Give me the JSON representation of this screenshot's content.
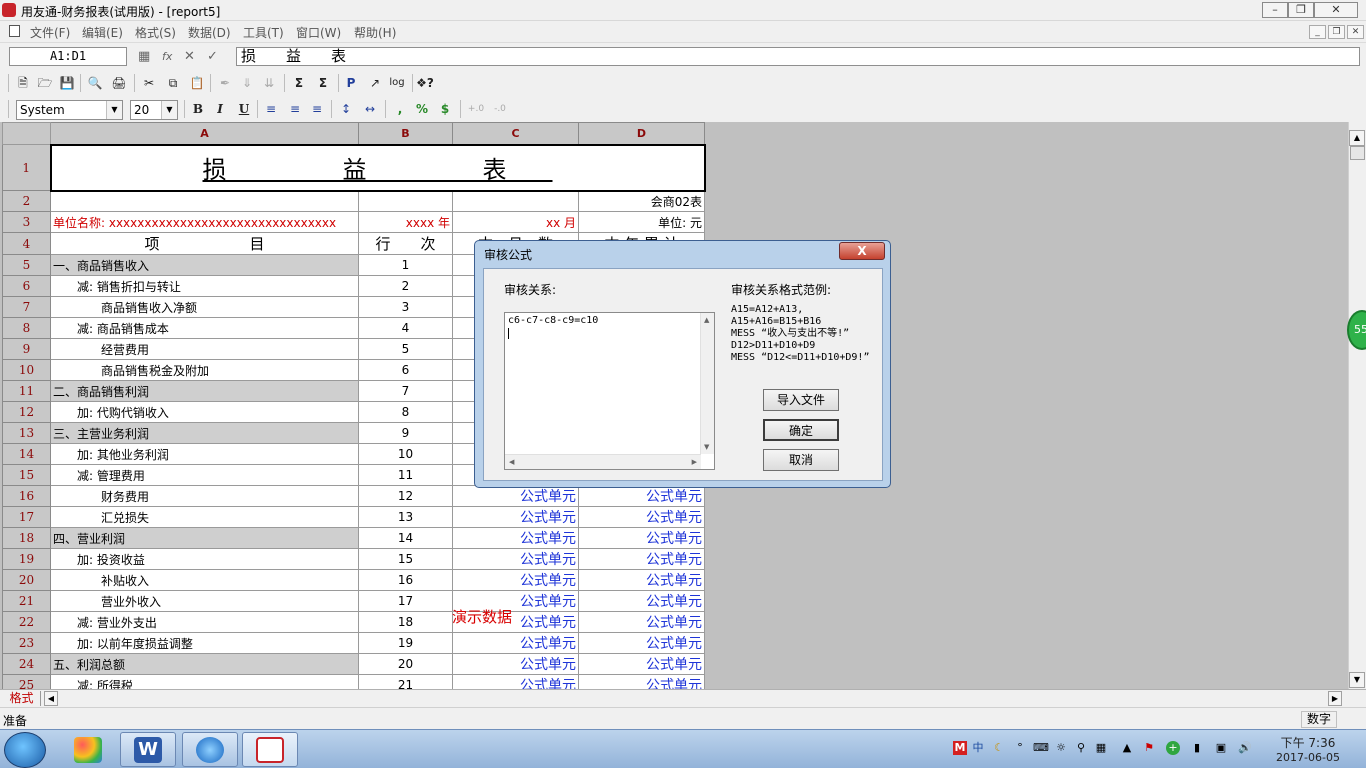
{
  "window": {
    "title": "用友通-财务报表(试用版) - [report5]",
    "controls": [
      "minimize",
      "restore",
      "close"
    ]
  },
  "menu": [
    "文件(F)",
    "编辑(E)",
    "格式(S)",
    "数据(D)",
    "工具(T)",
    "窗口(W)",
    "帮助(H)"
  ],
  "formula_bar": {
    "cell_ref": "A1:D1",
    "fx_label": "fx",
    "content": "损　　益　　表"
  },
  "format_bar": {
    "font": "System",
    "size": "20",
    "bold": "B",
    "italic": "I",
    "underline": "U",
    "comma": ",",
    "percent": "%",
    "currency": "$",
    "dec_add": "+.0",
    "dec_remove": "-.0"
  },
  "sheet": {
    "columns": [
      "A",
      "B",
      "C",
      "D"
    ],
    "title": "损　益　表",
    "row2_d": "会商02表",
    "row3": {
      "a": "单位名称: xxxxxxxxxxxxxxxxxxxxxxxxxxxxxxxx",
      "b": "xxxx 年",
      "c": "xx 月",
      "d": "单位: 元"
    },
    "row4": {
      "a": "项　　　　　　目",
      "b": "行　　次",
      "c": "本　月　数",
      "d": "本 年 累 计"
    },
    "rows": [
      {
        "n": "5",
        "item": "一、商品销售收入",
        "line": "1",
        "gray": true,
        "c": "",
        "d": ""
      },
      {
        "n": "6",
        "item": "　　减: 销售折扣与转让",
        "line": "2",
        "gray": false,
        "c": "",
        "d": ""
      },
      {
        "n": "7",
        "item": "　　　　商品销售收入净额",
        "line": "3",
        "gray": false,
        "c": "",
        "d": ""
      },
      {
        "n": "8",
        "item": "　　减: 商品销售成本",
        "line": "4",
        "gray": false,
        "c": "",
        "d": ""
      },
      {
        "n": "9",
        "item": "　　　　经营费用",
        "line": "5",
        "gray": false,
        "c": "",
        "d": ""
      },
      {
        "n": "10",
        "item": "　　　　商品销售税金及附加",
        "line": "6",
        "gray": false,
        "c": "",
        "d": ""
      },
      {
        "n": "11",
        "item": "二、商品销售利润",
        "line": "7",
        "gray": true,
        "c": "",
        "d": ""
      },
      {
        "n": "12",
        "item": "　　加: 代购代销收入",
        "line": "8",
        "gray": false,
        "c": "",
        "d": ""
      },
      {
        "n": "13",
        "item": "三、主营业务利润",
        "line": "9",
        "gray": true,
        "c": "",
        "d": ""
      },
      {
        "n": "14",
        "item": "　　加: 其他业务利润",
        "line": "10",
        "gray": false,
        "c": "",
        "d": ""
      },
      {
        "n": "15",
        "item": "　　减: 管理费用",
        "line": "11",
        "gray": false,
        "c": "",
        "d": ""
      },
      {
        "n": "16",
        "item": "　　　　财务费用",
        "line": "12",
        "gray": false,
        "c": "公式单元",
        "d": "公式单元"
      },
      {
        "n": "17",
        "item": "　　　　汇兑损失",
        "line": "13",
        "gray": false,
        "c": "公式单元",
        "d": "公式单元"
      },
      {
        "n": "18",
        "item": "四、营业利润",
        "line": "14",
        "gray": true,
        "c": "公式单元",
        "d": "公式单元"
      },
      {
        "n": "19",
        "item": "　　加: 投资收益",
        "line": "15",
        "gray": false,
        "c": "公式单元",
        "d": "公式单元"
      },
      {
        "n": "20",
        "item": "　　　　补贴收入",
        "line": "16",
        "gray": false,
        "c": "公式单元",
        "d": "公式单元"
      },
      {
        "n": "21",
        "item": "　　　　营业外收入",
        "line": "17",
        "gray": false,
        "c": "公式单元",
        "d": "公式单元"
      },
      {
        "n": "22",
        "item": "　　减: 营业外支出",
        "line": "18",
        "gray": false,
        "c": "公式单元",
        "d": "公式单元"
      },
      {
        "n": "23",
        "item": "　　加: 以前年度损益调整",
        "line": "19",
        "gray": false,
        "c": "公式单元",
        "d": "公式单元"
      },
      {
        "n": "24",
        "item": "五、利润总额",
        "line": "20",
        "gray": true,
        "c": "公式单元",
        "d": "公式单元"
      },
      {
        "n": "25",
        "item": "　　减: 所得税",
        "line": "21",
        "gray": false,
        "c": "公式单元",
        "d": "公式单元"
      }
    ],
    "demo_text": "演示数据"
  },
  "sheet_tab": "格式",
  "status": {
    "left": "准备",
    "right": "数字"
  },
  "tray_badge": "55",
  "taskbar": {
    "time": "下午 7:36",
    "date": "2017-06-05",
    "ime": "中"
  },
  "dialog": {
    "title": "审核公式",
    "close": "X",
    "relation_label": "审核关系:",
    "relation_text": "c6-c7-c8-c9=c10",
    "example_label": "审核关系格式范例:",
    "examples": [
      "A15=A12+A13,",
      "A15+A16=B15+B16",
      "MESS “收入与支出不等!”",
      "D12>D11+D10+D9",
      "MESS “D12<=D11+D10+D9!”"
    ],
    "buttons": {
      "import": "导入文件",
      "ok": "确定",
      "cancel": "取消"
    }
  }
}
